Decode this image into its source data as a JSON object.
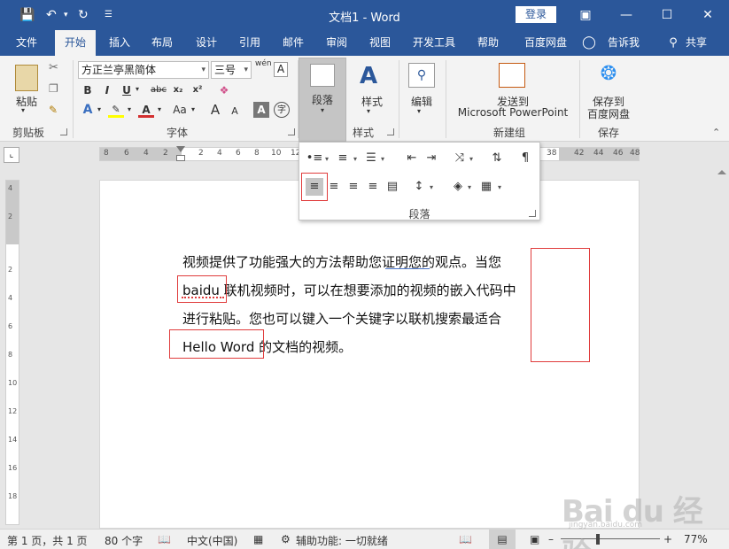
{
  "window": {
    "title": "文档1  -  Word",
    "login": "登录"
  },
  "tabs": [
    "文件",
    "开始",
    "插入",
    "布局",
    "设计",
    "引用",
    "邮件",
    "审阅",
    "视图",
    "开发工具",
    "帮助",
    "百度网盘",
    "告诉我",
    "共享"
  ],
  "ribbon": {
    "clipboard": {
      "paste": "粘贴",
      "label": "剪贴板"
    },
    "font": {
      "name": "方正兰亭黑简体",
      "size": "三号",
      "label": "字体",
      "phonetic": "wén"
    },
    "paragraph": {
      "label": "段落"
    },
    "styles": {
      "button": "样式",
      "label": "样式"
    },
    "editing": {
      "button": "编辑"
    },
    "newgroup": {
      "send_line1": "发送到",
      "send_line2": "Microsoft PowerPoint",
      "label": "新建组"
    },
    "save": {
      "line1": "保存到",
      "line2": "百度网盘",
      "label": "保存"
    }
  },
  "ruler": {
    "h_left": [
      "8",
      "6",
      "4",
      "2"
    ],
    "h_right": [
      "2",
      "4",
      "6",
      "8",
      "10",
      "12",
      "14",
      "16"
    ],
    "h_far": [
      "38",
      "42",
      "44",
      "46",
      "48"
    ],
    "v": [
      "4",
      "2",
      "2",
      "4",
      "6",
      "8",
      "10",
      "12",
      "14",
      "16",
      "18",
      "20",
      "22",
      "24"
    ]
  },
  "paragraph_panel": {
    "label": "段落",
    "row1": [
      "bullets-icon",
      "numbering-icon",
      "multilevel-list-icon",
      "decrease-indent-icon",
      "increase-indent-icon",
      "chinese-layout-icon",
      "sort-icon",
      "show-marks-icon"
    ],
    "row2": [
      "align-left-icon",
      "align-center-icon",
      "align-right-icon",
      "justify-icon",
      "distributed-icon",
      "line-spacing-icon",
      "shading-icon",
      "borders-icon"
    ],
    "selected": "align-left-icon"
  },
  "document": {
    "lines": [
      "视频提供了功能强大的方法帮助您证明您的观点。当您",
      "baidu 联机视频时，可以在想要添加的视频的嵌入代码中",
      "进行粘贴。您也可以键入一个关键字以联机搜索最适合",
      "Hello Word 的文档的视频。"
    ]
  },
  "status": {
    "page": "第 1 页，共 1 页",
    "words": "80 个字",
    "language": "中文(中国)",
    "accessibility": "辅助功能: 一切就绪",
    "zoom": "77%",
    "zoom_level": 0.77
  },
  "watermark": {
    "logo": "Bai du 经验",
    "sub": "jingyan.baidu.com"
  },
  "colors": {
    "accent": "#2b579a",
    "highlight": "#e03c3c",
    "font_color": "#d32f2f",
    "highlight_color": "#ffff00"
  }
}
